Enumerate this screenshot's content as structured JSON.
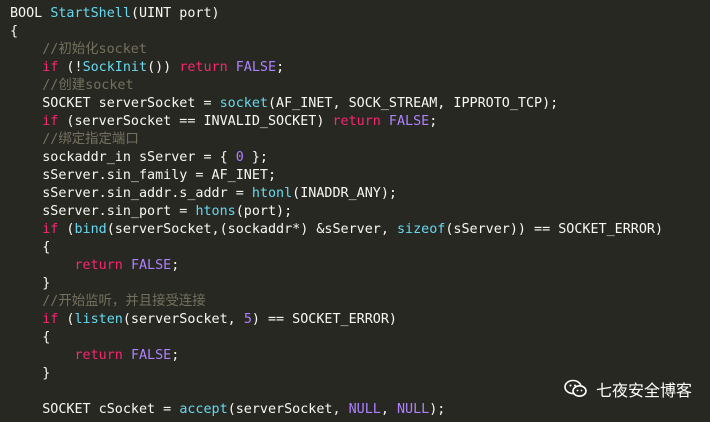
{
  "colors": {
    "background": "#272822",
    "plain": "#f8f8f2",
    "keyword": "#f92672",
    "function": "#66d9ef",
    "comment": "#75715e",
    "constant": "#ae81ff"
  },
  "code_lines": [
    [
      {
        "t": "BOOL ",
        "c": "plain"
      },
      {
        "t": "StartShell",
        "c": "fn"
      },
      {
        "t": "(UINT port)",
        "c": "plain"
      }
    ],
    [
      {
        "t": "{",
        "c": "plain"
      }
    ],
    [
      {
        "t": "    //初始化socket",
        "c": "cm"
      }
    ],
    [
      {
        "t": "    ",
        "c": "plain"
      },
      {
        "t": "if",
        "c": "kw"
      },
      {
        "t": " (!",
        "c": "plain"
      },
      {
        "t": "SockInit",
        "c": "fn"
      },
      {
        "t": "()) ",
        "c": "plain"
      },
      {
        "t": "return",
        "c": "kw"
      },
      {
        "t": " ",
        "c": "plain"
      },
      {
        "t": "FALSE",
        "c": "cst"
      },
      {
        "t": ";",
        "c": "plain"
      }
    ],
    [
      {
        "t": "    //创建socket",
        "c": "cm"
      }
    ],
    [
      {
        "t": "    SOCKET serverSocket = ",
        "c": "plain"
      },
      {
        "t": "socket",
        "c": "fn"
      },
      {
        "t": "(AF_INET, SOCK_STREAM, IPPROTO_TCP);",
        "c": "plain"
      }
    ],
    [
      {
        "t": "    ",
        "c": "plain"
      },
      {
        "t": "if",
        "c": "kw"
      },
      {
        "t": " (serverSocket == INVALID_SOCKET) ",
        "c": "plain"
      },
      {
        "t": "return",
        "c": "kw"
      },
      {
        "t": " ",
        "c": "plain"
      },
      {
        "t": "FALSE",
        "c": "cst"
      },
      {
        "t": ";",
        "c": "plain"
      }
    ],
    [
      {
        "t": "    //绑定指定端口",
        "c": "cm"
      }
    ],
    [
      {
        "t": "    sockaddr_in sServer = { ",
        "c": "plain"
      },
      {
        "t": "0",
        "c": "num"
      },
      {
        "t": " };",
        "c": "plain"
      }
    ],
    [
      {
        "t": "    sServer.sin_family = AF_INET;",
        "c": "plain"
      }
    ],
    [
      {
        "t": "    sServer.sin_addr.s_addr = ",
        "c": "plain"
      },
      {
        "t": "htonl",
        "c": "fn"
      },
      {
        "t": "(INADDR_ANY);",
        "c": "plain"
      }
    ],
    [
      {
        "t": "    sServer.sin_port = ",
        "c": "plain"
      },
      {
        "t": "htons",
        "c": "fn"
      },
      {
        "t": "(port);",
        "c": "plain"
      }
    ],
    [
      {
        "t": "    ",
        "c": "plain"
      },
      {
        "t": "if",
        "c": "kw"
      },
      {
        "t": " (",
        "c": "plain"
      },
      {
        "t": "bind",
        "c": "fn"
      },
      {
        "t": "(serverSocket,(sockaddr*) &sServer, ",
        "c": "plain"
      },
      {
        "t": "sizeof",
        "c": "fn"
      },
      {
        "t": "(sServer)) == SOCKET_ERROR)",
        "c": "plain"
      }
    ],
    [
      {
        "t": "    {",
        "c": "plain"
      }
    ],
    [
      {
        "t": "        ",
        "c": "plain"
      },
      {
        "t": "return",
        "c": "kw"
      },
      {
        "t": " ",
        "c": "plain"
      },
      {
        "t": "FALSE",
        "c": "cst"
      },
      {
        "t": ";",
        "c": "plain"
      }
    ],
    [
      {
        "t": "    }",
        "c": "plain"
      }
    ],
    [
      {
        "t": "    //开始监听，并且接受连接",
        "c": "cm"
      }
    ],
    [
      {
        "t": "    ",
        "c": "plain"
      },
      {
        "t": "if",
        "c": "kw"
      },
      {
        "t": " (",
        "c": "plain"
      },
      {
        "t": "listen",
        "c": "fn"
      },
      {
        "t": "(serverSocket, ",
        "c": "plain"
      },
      {
        "t": "5",
        "c": "num"
      },
      {
        "t": ") == SOCKET_ERROR)",
        "c": "plain"
      }
    ],
    [
      {
        "t": "    {",
        "c": "plain"
      }
    ],
    [
      {
        "t": "        ",
        "c": "plain"
      },
      {
        "t": "return",
        "c": "kw"
      },
      {
        "t": " ",
        "c": "plain"
      },
      {
        "t": "FALSE",
        "c": "cst"
      },
      {
        "t": ";",
        "c": "plain"
      }
    ],
    [
      {
        "t": "    }",
        "c": "plain"
      }
    ],
    [
      {
        "t": "",
        "c": "plain"
      }
    ],
    [
      {
        "t": "    SOCKET cSocket = ",
        "c": "plain"
      },
      {
        "t": "accept",
        "c": "fn"
      },
      {
        "t": "(serverSocket, ",
        "c": "plain"
      },
      {
        "t": "NULL",
        "c": "cst"
      },
      {
        "t": ", ",
        "c": "plain"
      },
      {
        "t": "NULL",
        "c": "cst"
      },
      {
        "t": ");",
        "c": "plain"
      }
    ]
  ],
  "watermark": {
    "icon": "wechat-icon",
    "text": "七夜安全博客"
  }
}
